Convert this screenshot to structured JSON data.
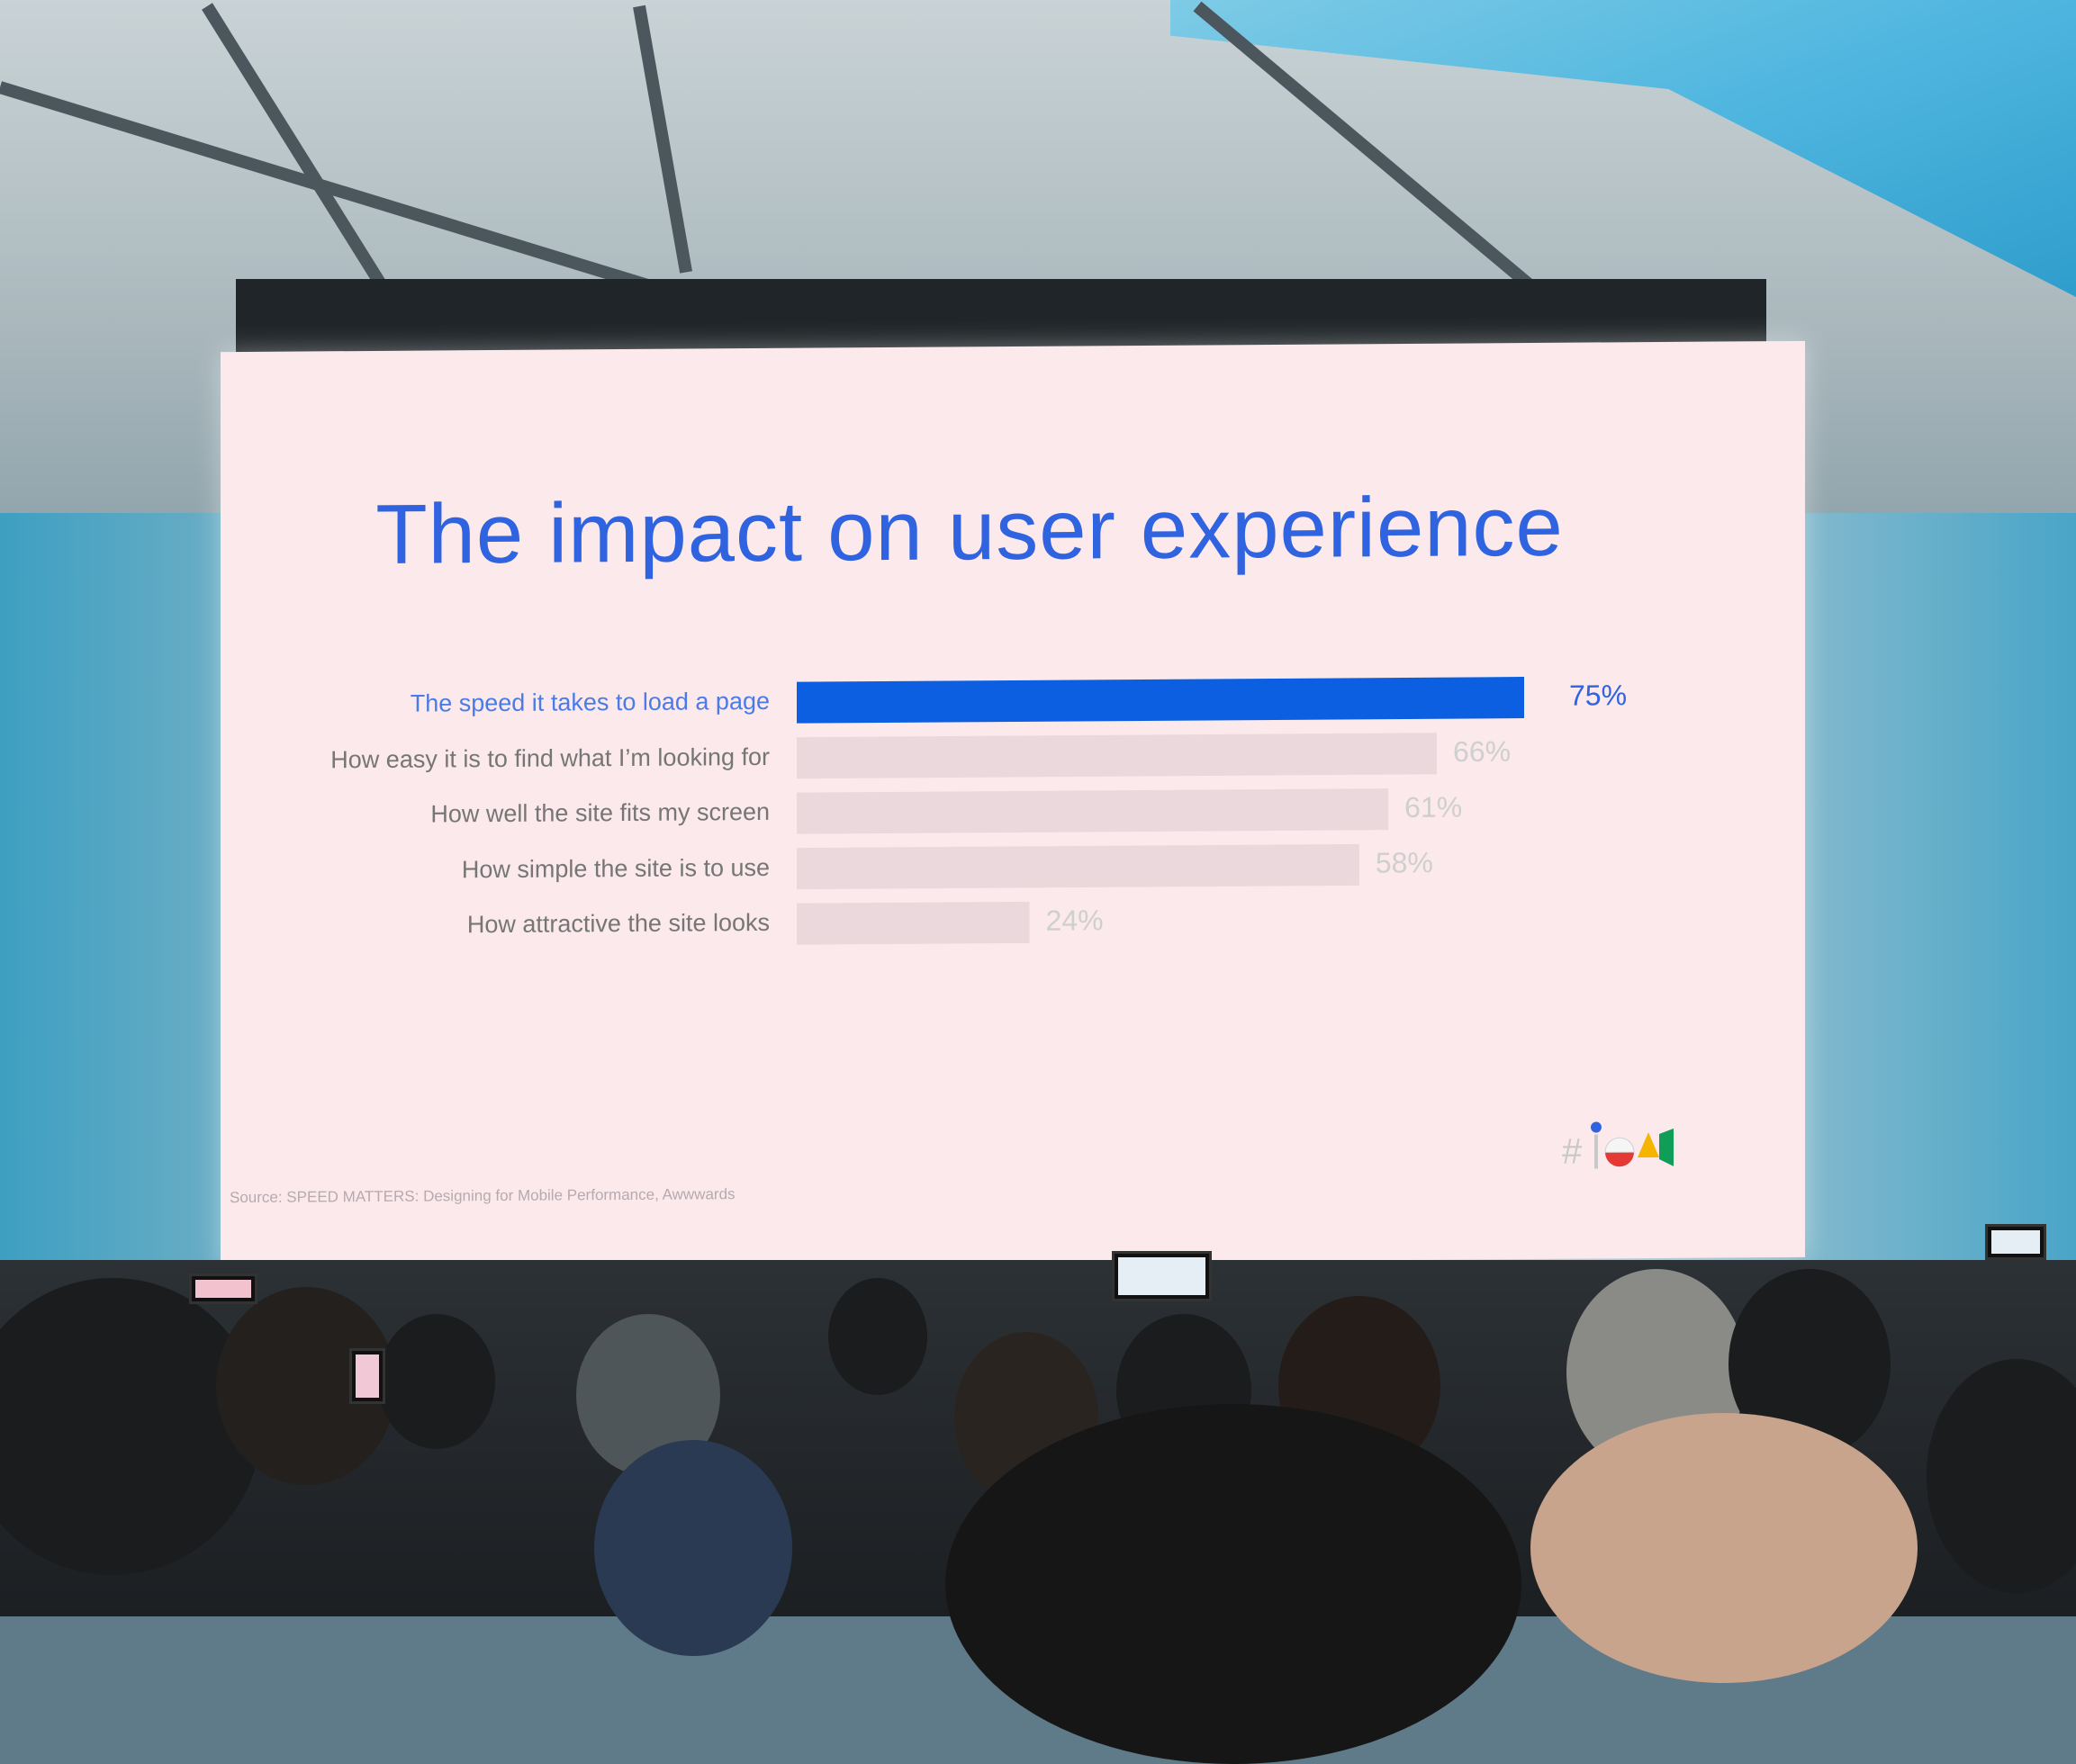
{
  "slide": {
    "title": "The impact on user experience",
    "source": "Source: SPEED MATTERS: Designing for Mobile Performance, Awwwards"
  },
  "colors": {
    "highlight_bar": "#0b5fe0",
    "muted_bar": "#ead8dc",
    "title": "#2f63e0"
  },
  "chart_data": {
    "type": "bar",
    "orientation": "horizontal",
    "title": "The impact on user experience",
    "categories": [
      "The speed it takes to load a page",
      "How easy it is to find what I’m looking for",
      "How well the site fits my screen",
      "How simple the site is to use",
      "How attractive the site looks"
    ],
    "values": [
      75,
      66,
      61,
      58,
      24
    ],
    "value_labels": [
      "75%",
      "66%",
      "61%",
      "58%",
      "24%"
    ],
    "highlighted_index": 0,
    "grid": false,
    "legend": "none"
  },
  "icons": {
    "logo": "google-io-logo-icon"
  }
}
